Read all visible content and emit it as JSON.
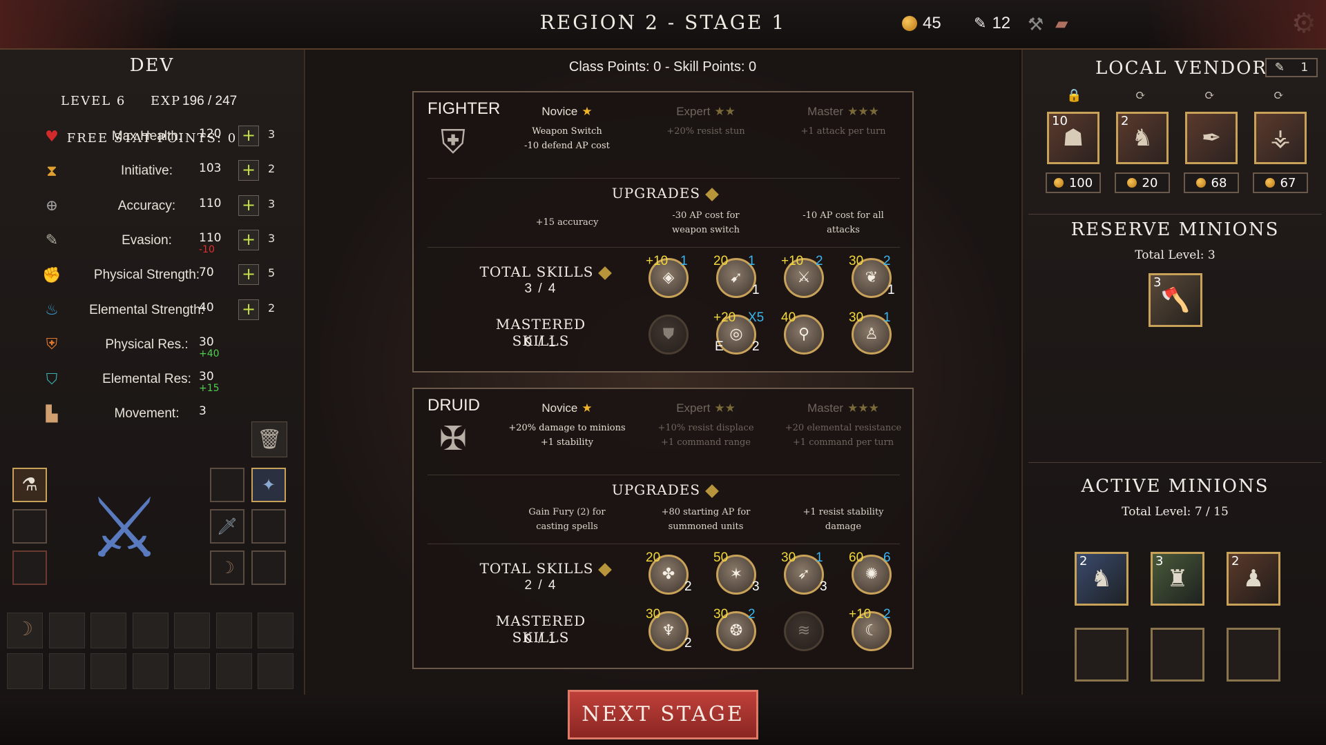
{
  "header": {
    "title": "REGION 2 - STAGE 1",
    "gold": "45",
    "scrolls": "12",
    "gear_icon": "gear-icon"
  },
  "character": {
    "name": "DEV",
    "level_label": "LEVEL 6",
    "exp_label": "EXP",
    "exp_value": "196 / 247",
    "free_points": "FREE STAT POINTS: 0",
    "stats": [
      {
        "label": "Max Health:",
        "value": "120",
        "cost": "3",
        "icon": "heart-icon",
        "color": "#d02a2a"
      },
      {
        "label": "Initiative:",
        "value": "103",
        "cost": "2",
        "icon": "hourglass-icon",
        "color": "#e0a030"
      },
      {
        "label": "Accuracy:",
        "value": "110",
        "cost": "3",
        "icon": "crosshair-icon",
        "color": "#9a9a9a"
      },
      {
        "label": "Evasion:",
        "value": "110",
        "mod": "-10",
        "cost": "3",
        "icon": "feather-icon",
        "color": "#b0b0a0"
      },
      {
        "label": "Physical Strength:",
        "value": "70",
        "cost": "5",
        "icon": "arm-icon",
        "color": "#e08a30"
      },
      {
        "label": "Elemental Strength:",
        "value": "40",
        "cost": "2",
        "icon": "flame-icon",
        "color": "#3aa0d0"
      },
      {
        "label": "Physical Res.:",
        "value": "30",
        "mod": "+40",
        "icon": "armor-icon",
        "color": "#e07a30"
      },
      {
        "label": "Elemental Res:",
        "value": "30",
        "mod": "+15",
        "icon": "shield-icon",
        "color": "#3ab0b0"
      },
      {
        "label": "Movement:",
        "value": "3",
        "icon": "boot-icon",
        "color": "#d0a070"
      }
    ]
  },
  "classes": {
    "points": "Class Points: 0  -  Skill Points: 0",
    "fighter": {
      "name": "FIGHTER",
      "tiers": [
        {
          "name": "Novice",
          "stars": "★",
          "desc1": "Weapon Switch",
          "desc2": "-10 defend AP cost"
        },
        {
          "name": "Expert",
          "stars": "★★",
          "desc1": "+20% resist stun",
          "desc2": ""
        },
        {
          "name": "Master",
          "stars": "★★★",
          "desc1": "+1 attack per turn",
          "desc2": ""
        }
      ],
      "upgrades_title": "UPGRADES",
      "upgrades": [
        {
          "l1": "+15 accuracy",
          "l2": ""
        },
        {
          "l1": "-30 AP cost for",
          "l2": "weapon switch"
        },
        {
          "l1": "-10 AP cost for all",
          "l2": "attacks"
        }
      ],
      "total_label": "TOTAL SKILLS",
      "total_count": "3 / 4",
      "mastered_label": "MASTERED SKILLS",
      "mastered_count": "0 / 1",
      "total_skills": [
        {
          "tl": "+10",
          "tr": "1",
          "br": "",
          "bl": "",
          "icon": "diamond-hit-icon"
        },
        {
          "tl": "20",
          "tr": "1",
          "br": "1",
          "bl": "",
          "icon": "charge-icon"
        },
        {
          "tl": "+10",
          "tr": "2",
          "br": "",
          "bl": "",
          "icon": "sword-down-icon"
        },
        {
          "tl": "30",
          "tr": "2",
          "br": "1",
          "bl": "",
          "icon": "wings-icon"
        }
      ],
      "mastered_skills": [
        {
          "tl": "",
          "tr": "",
          "br": "",
          "bl": "",
          "icon": "shields-icon"
        },
        {
          "tl": "+20",
          "tr": "X5",
          "br": "2",
          "bl": "E",
          "icon": "swirl-icon"
        },
        {
          "tl": "40",
          "tr": "",
          "br": "",
          "bl": "",
          "icon": "lock-body-icon"
        },
        {
          "tl": "30",
          "tr": "1",
          "br": "",
          "bl": "",
          "icon": "figure-icon"
        }
      ]
    },
    "druid": {
      "name": "DRUID",
      "tiers": [
        {
          "name": "Novice",
          "stars": "★",
          "desc1": "+20% damage to minions",
          "desc2": "+1 stability"
        },
        {
          "name": "Expert",
          "stars": "★★",
          "desc1": "+10% resist displace",
          "desc2": "+1 command range"
        },
        {
          "name": "Master",
          "stars": "★★★",
          "desc1": "+20 elemental resistance",
          "desc2": "+1 command per turn"
        }
      ],
      "upgrades_title": "UPGRADES",
      "upgrades": [
        {
          "l1": "Gain Fury (2) for",
          "l2": "casting spells"
        },
        {
          "l1": "+80 starting AP for",
          "l2": "summoned units"
        },
        {
          "l1": "+1 resist stability",
          "l2": "damage"
        }
      ],
      "total_label": "TOTAL SKILLS",
      "total_count": "2 / 4",
      "mastered_label": "MASTERED SKILLS",
      "mastered_count": "0 / 1",
      "total_skills": [
        {
          "tl": "20",
          "tr": "",
          "br": "2",
          "bl": "",
          "icon": "paw-icon"
        },
        {
          "tl": "50",
          "tr": "",
          "br": "3",
          "bl": "",
          "icon": "beast-icon"
        },
        {
          "tl": "30",
          "tr": "1",
          "br": "3",
          "bl": "",
          "icon": "leap-icon"
        },
        {
          "tl": "60",
          "tr": "6",
          "br": "",
          "bl": "",
          "icon": "claw-fire-icon"
        }
      ],
      "mastered_skills": [
        {
          "tl": "30",
          "tr": "",
          "br": "2",
          "bl": "",
          "icon": "spirit-icon"
        },
        {
          "tl": "30",
          "tr": "2",
          "br": "",
          "bl": "",
          "icon": "wolf-icon"
        },
        {
          "tl": "",
          "tr": "",
          "br": "",
          "bl": "",
          "icon": "slash-icon"
        },
        {
          "tl": "+10",
          "tr": "2",
          "br": "",
          "bl": "",
          "icon": "wave-icon"
        }
      ]
    }
  },
  "vendor": {
    "title": "LOCAL VENDOR",
    "scroll_count": "1",
    "items": [
      {
        "level": "10",
        "price": "100",
        "icon": "ogre-icon",
        "top": "lock-icon"
      },
      {
        "level": "2",
        "price": "20",
        "icon": "goblin-icon",
        "top": "refresh-icon"
      },
      {
        "level": "",
        "price": "68",
        "icon": "feather-item-icon",
        "top": "refresh-icon"
      },
      {
        "level": "",
        "price": "67",
        "icon": "claw-item-icon",
        "top": "refresh-icon"
      }
    ]
  },
  "reserve": {
    "title": "RESERVE MINIONS",
    "total": "Total Level: 3",
    "minions": [
      {
        "level": "3",
        "icon": "dwarf-icon"
      }
    ]
  },
  "active": {
    "title": "ACTIVE MINIONS",
    "total": "Total Level: 7 / 15",
    "minions": [
      {
        "level": "2",
        "icon": "goblin-icon"
      },
      {
        "level": "3",
        "icon": "orc-icon"
      },
      {
        "level": "2",
        "icon": "warrior-icon"
      }
    ]
  },
  "footer": {
    "next_label": "NEXT STAGE"
  }
}
